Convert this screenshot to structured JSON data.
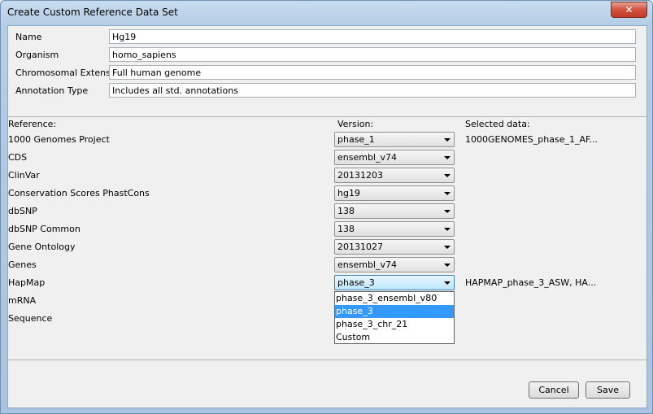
{
  "window": {
    "title": "Create Custom Reference Data Set",
    "close_glyph": "✕"
  },
  "form": {
    "name_label": "Name",
    "name_value": "Hg19",
    "organism_label": "Organism",
    "organism_value": "homo_sapiens",
    "extension_label": "Chromosomal Extension",
    "extension_value": "Full human genome",
    "annotation_label": "Annotation Type",
    "annotation_value": "Includes all std. annotations"
  },
  "headers": {
    "reference": "Reference:",
    "version": "Version:",
    "selected": "Selected data:"
  },
  "references": [
    {
      "label": "1000 Genomes Project",
      "version": "phase_1",
      "selected": "1000GENOMES_phase_1_AF..."
    },
    {
      "label": "CDS",
      "version": "ensembl_v74",
      "selected": ""
    },
    {
      "label": "ClinVar",
      "version": "20131203",
      "selected": ""
    },
    {
      "label": "Conservation Scores PhastCons",
      "version": "hg19",
      "selected": ""
    },
    {
      "label": "dbSNP",
      "version": "138",
      "selected": ""
    },
    {
      "label": "dbSNP Common",
      "version": "138",
      "selected": ""
    },
    {
      "label": "Gene Ontology",
      "version": "20131027",
      "selected": ""
    },
    {
      "label": "Genes",
      "version": "ensembl_v74",
      "selected": ""
    },
    {
      "label": "HapMap",
      "version": "phase_3",
      "selected": "HAPMAP_phase_3_ASW, HA..."
    },
    {
      "label": "mRNA",
      "version": "",
      "selected": ""
    },
    {
      "label": "Sequence",
      "version": "",
      "selected": ""
    }
  ],
  "dropdown": {
    "options": [
      "phase_3_ensembl_v80",
      "phase_3",
      "phase_3_chr_21",
      "Custom"
    ],
    "selected": "phase_3"
  },
  "buttons": {
    "cancel": "Cancel",
    "save": "Save"
  }
}
